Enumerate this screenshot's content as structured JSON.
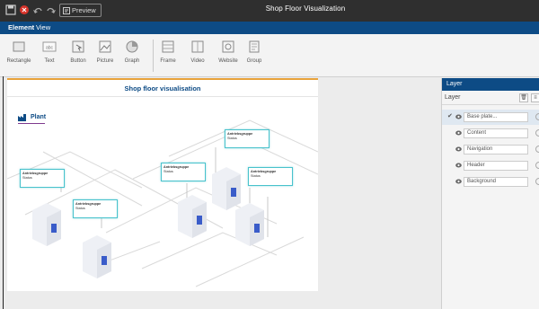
{
  "window": {
    "title": "Shop Floor Visualization",
    "preview_label": "Preview"
  },
  "menu": {
    "items": [
      "Element",
      "View"
    ]
  },
  "ribbon": {
    "group1": [
      "Rectangle",
      "Text",
      "Button",
      "Picture",
      "Graph"
    ],
    "group2": [
      "Frame",
      "Video",
      "Website",
      "Group"
    ]
  },
  "canvas": {
    "title": "Shop floor visualisation",
    "plant_label": "Plant",
    "devices": [
      {
        "name": "Antriebsgruppe",
        "status": "Status"
      },
      {
        "name": "Antriebsgruppe",
        "status": "Status"
      },
      {
        "name": "Antriebsgruppe",
        "status": "Status"
      },
      {
        "name": "Antriebsgruppe",
        "status": "Status"
      },
      {
        "name": "Antriebsgruppe",
        "status": "Status"
      }
    ]
  },
  "layer_panel": {
    "header": "Layer",
    "sub_label": "Layer",
    "layers": [
      {
        "name": "Base plate..."
      },
      {
        "name": "Content"
      },
      {
        "name": "Navigation"
      },
      {
        "name": "Header"
      },
      {
        "name": "Background"
      }
    ]
  },
  "colors": {
    "title_bar": "#2f2f2f",
    "menu_bar": "#0d4b85",
    "accent": "#e8a23a",
    "label_border": "#48c2cc"
  }
}
